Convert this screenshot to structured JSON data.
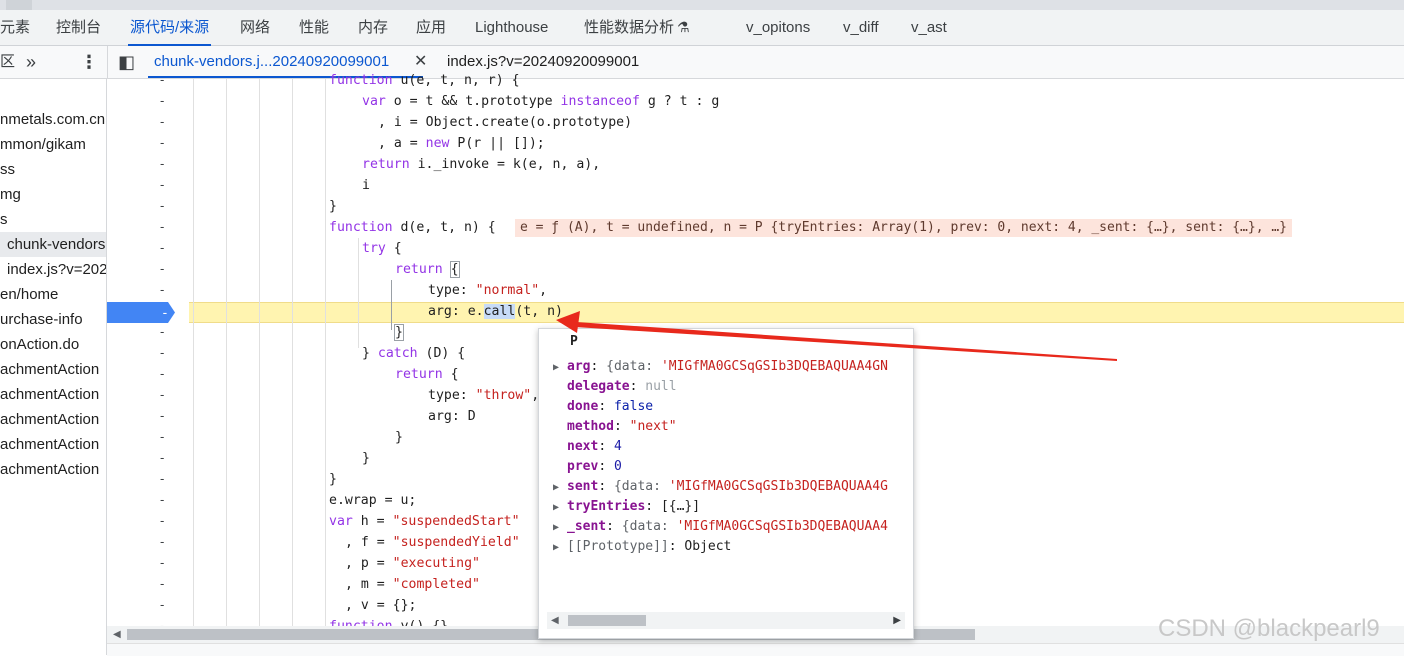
{
  "main_tabs": [
    {
      "label": "元素"
    },
    {
      "label": "控制台"
    },
    {
      "label": "源代码/来源"
    },
    {
      "label": "网络"
    },
    {
      "label": "性能"
    },
    {
      "label": "内存"
    },
    {
      "label": "应用"
    },
    {
      "label": "Lighthouse"
    },
    {
      "label": "性能数据分析"
    },
    {
      "label": "v_opitons"
    },
    {
      "label": "v_diff"
    },
    {
      "label": "v_ast"
    }
  ],
  "sources_toolbar": {
    "left_label": "区",
    "more_chevron": "»",
    "menu_dots": "⋮",
    "sidebar_toggle": "◧",
    "file_tabs": [
      {
        "label": "chunk-vendors.j...20240920099001",
        "close": "✕"
      },
      {
        "label": "index.js?v=20240920099001"
      }
    ]
  },
  "navigator": {
    "items": [
      {
        "label": "nmetals.com.cn"
      },
      {
        "label": "mmon/gikam"
      },
      {
        "label": "ss"
      },
      {
        "label": "mg"
      },
      {
        "label": "s"
      },
      {
        "label": "chunk-vendors"
      },
      {
        "label": "index.js?v=202"
      },
      {
        "label": "en/home"
      },
      {
        "label": "urchase-info"
      },
      {
        "label": "onAction.do"
      },
      {
        "label": "achmentAction"
      },
      {
        "label": "achmentAction"
      },
      {
        "label": "achmentAction"
      },
      {
        "label": "achmentAction"
      },
      {
        "label": "achmentAction"
      }
    ]
  },
  "inline_values": "e = ƒ (A), t = undefined, n = P {tryEntries: Array(1), prev: 0, next: 4, _sent: {…}, sent: {…}, …}",
  "popover": {
    "title": "P",
    "props": [
      {
        "key": "arg",
        "sep": ": ",
        "v1": "{data: ",
        "v2": "'MIGfMA0GCSqGSIb3DQEBAQUAA4GN"
      },
      {
        "key": "delegate",
        "sep": ": ",
        "v1": "null"
      },
      {
        "key": "done",
        "sep": ": ",
        "v1": "false"
      },
      {
        "key": "method",
        "sep": ": ",
        "v1": "\"next\""
      },
      {
        "key": "next",
        "sep": ": ",
        "v1": "4"
      },
      {
        "key": "prev",
        "sep": ": ",
        "v1": "0"
      },
      {
        "key": "sent",
        "sep": ": ",
        "v1": "{data: ",
        "v2": "'MIGfMA0GCSqGSIb3DQEBAQUAA4G"
      },
      {
        "key": "tryEntries",
        "sep": ": ",
        "v1": "[{…}]"
      },
      {
        "key": "_sent",
        "sep": ": ",
        "v1": "{data: ",
        "v2": "'MIGfMA0GCSqGSIb3DQEBAQUAA4"
      },
      {
        "key": "[[Prototype]]",
        "sep": ": ",
        "v1": "Object"
      }
    ]
  },
  "watermark": "CSDN @blackpearl9",
  "colors": {
    "accent": "#0b57d0",
    "exec_line": "#fff4b0",
    "inline_values_bg": "#fde4dc",
    "arrow": "#e8291c",
    "keyword": "#9334e6",
    "string": "#c5221f"
  },
  "icons": {
    "flask": "flask-icon",
    "sidebar_toggle": "sidebar-toggle-icon",
    "more": "chevron-double-right-icon",
    "menu": "kebab-menu-icon",
    "breakpoint": "breakpoint-marker-icon"
  }
}
